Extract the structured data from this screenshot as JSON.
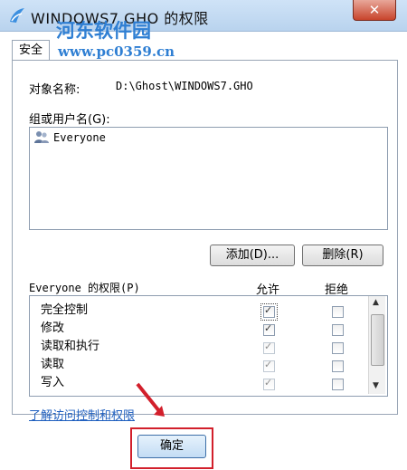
{
  "window": {
    "title": "WINDOWS7.GHO 的权限",
    "close_label": "✕"
  },
  "watermark": {
    "site_name": "河东软件园",
    "url": "www.pc0359.cn"
  },
  "tabs": [
    {
      "label": "安全"
    }
  ],
  "object": {
    "label": "对象名称:",
    "value": "D:\\Ghost\\WINDOWS7.GHO"
  },
  "groups": {
    "label": "组或用户名(G):",
    "items": [
      "Everyone"
    ]
  },
  "buttons": {
    "add": "添加(D)...",
    "remove": "删除(R)",
    "ok": "确定"
  },
  "permissions": {
    "label": "Everyone 的权限(P)",
    "allow_header": "允许",
    "deny_header": "拒绝",
    "rows": [
      {
        "name": "完全控制",
        "allow": true,
        "deny": false,
        "allow_enabled": true
      },
      {
        "name": "修改",
        "allow": true,
        "deny": false,
        "allow_enabled": true
      },
      {
        "name": "读取和执行",
        "allow": true,
        "deny": false,
        "allow_enabled": false
      },
      {
        "name": "读取",
        "allow": true,
        "deny": false,
        "allow_enabled": false
      },
      {
        "name": "写入",
        "allow": true,
        "deny": false,
        "allow_enabled": false
      }
    ]
  },
  "link": {
    "label": "了解访问控制和权限"
  },
  "colors": {
    "link": "#1f5fbf",
    "highlight": "#d21f2b",
    "watermark": "#2f7fd3"
  }
}
